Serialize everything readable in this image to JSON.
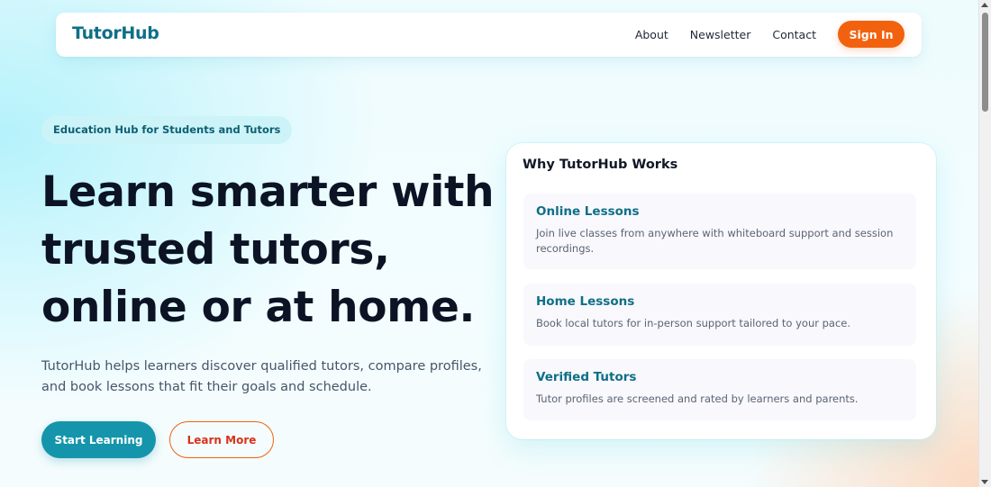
{
  "navbar": {
    "brand": "TutorHub",
    "links": [
      "About",
      "Newsletter",
      "Contact"
    ],
    "signin_label": "Sign In"
  },
  "hero": {
    "badge": "Education Hub for Students and Tutors",
    "title_lines": [
      "Learn smarter with",
      "trusted tutors,",
      "online or at home."
    ],
    "description_lines": [
      "TutorHub helps learners discover qualified tutors, compare profiles,",
      "and book lessons that fit their goals and schedule."
    ],
    "primary_cta": "Start Learning",
    "secondary_cta": "Learn More"
  },
  "card": {
    "title": "Why TutorHub Works",
    "features": [
      {
        "title": "Online Lessons",
        "description_lines": [
          "Join live classes from anywhere with whiteboard support and session",
          "recordings."
        ]
      },
      {
        "title": "Home Lessons",
        "description_lines": [
          "Book local tutors for in-person support tailored to your pace."
        ]
      },
      {
        "title": "Verified Tutors",
        "description_lines": [
          "Tutor profiles are screened and rated by learners and parents."
        ]
      }
    ]
  },
  "colors": {
    "brand": "#0e6f86",
    "accent_orange": "#f2620e",
    "primary_teal": "#1595ab",
    "badge_bg": "#ccf4f8"
  }
}
